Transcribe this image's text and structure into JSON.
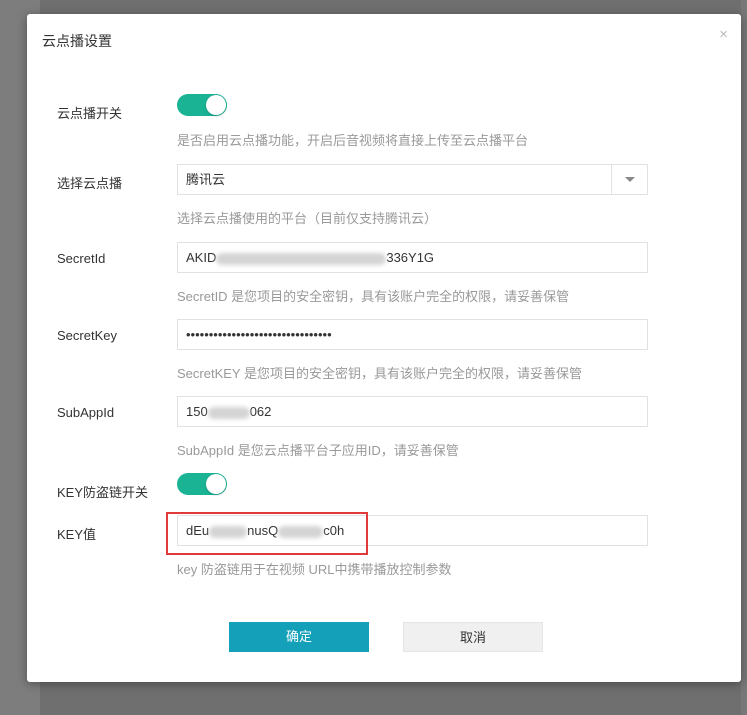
{
  "dialog": {
    "title": "云点播设置",
    "close_symbol": "×"
  },
  "vod_switch": {
    "label": "云点播开关",
    "enabled": true,
    "hint": "是否启用云点播功能，开启后音视频将直接上传至云点播平台"
  },
  "platform": {
    "label": "选择云点播",
    "value": "腾讯云",
    "hint": "选择云点播使用的平台（目前仅支持腾讯云）"
  },
  "secret_id": {
    "label": "SecretId",
    "value_start": "AKID",
    "value_end": "336Y1G",
    "hint": "SecretID 是您项目的安全密钥，具有该账户完全的权限，请妥善保管"
  },
  "secret_key": {
    "label": "SecretKey",
    "value": "••••••••••••••••••••••••••••••••",
    "hint": "SecretKEY 是您项目的安全密钥，具有该账户完全的权限，请妥善保管"
  },
  "sub_app_id": {
    "label": "SubAppId",
    "value_start": "150",
    "value_end": "062",
    "hint": "SubAppId 是您云点播平台子应用ID，请妥善保管"
  },
  "key_switch": {
    "label": "KEY防盗链开关",
    "enabled": true
  },
  "key_value": {
    "label": "KEY值",
    "value_start": "dEu",
    "value_mid": "nusQ",
    "value_end": "c0h",
    "hint": "key 防盗链用于在视频 URL中携带播放控制参数"
  },
  "buttons": {
    "confirm": "确定",
    "cancel": "取消"
  },
  "colors": {
    "toggle_on": "#1ab394",
    "primary_button": "#14a0b8",
    "highlight_border": "#e03a3a"
  }
}
